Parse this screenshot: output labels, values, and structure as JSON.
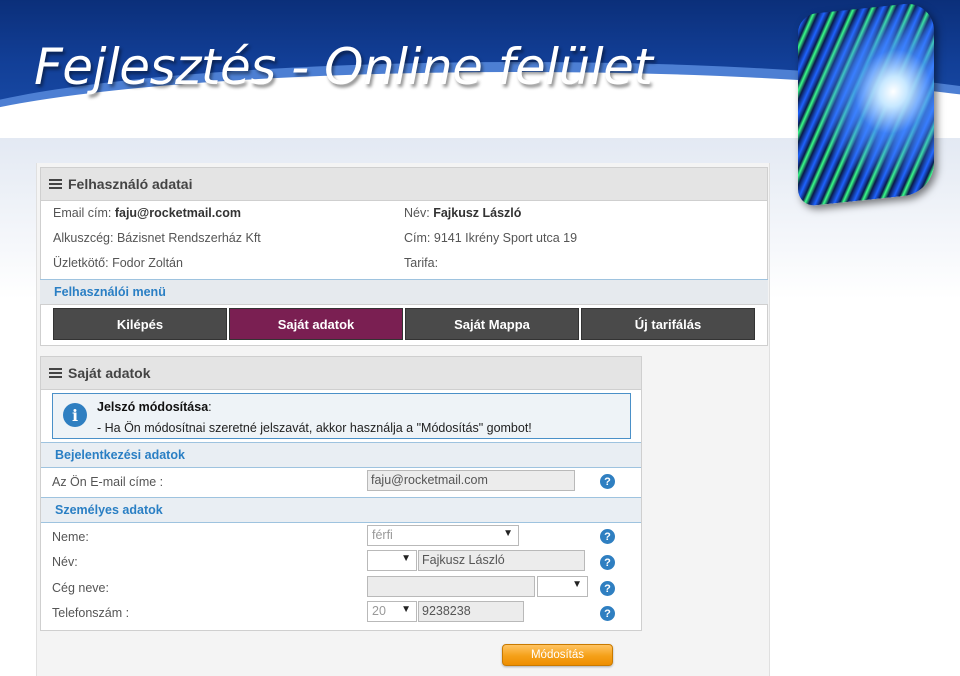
{
  "slide": {
    "title": "Fejlesztés - Online felület",
    "logo_icon": "light-tunnel-logo"
  },
  "user_panel": {
    "title": "Felhasználó adatai",
    "icon": "menu-icon",
    "email_label": "Email cím:",
    "email_value": "faju@rocketmail.com",
    "name_label": "Név:",
    "name_value": "Fajkusz László",
    "subagency_label": "Alkuszcég:",
    "subagency_value": "Bázisnet Rendszerház Kft",
    "address_label": "Cím:",
    "address_value": "9141 Ikrény Sport utca 19",
    "agent_label": "Üzletkötő:",
    "agent_value": "Fodor Zoltán",
    "tariff_label": "Tarifa:",
    "tariff_value": ""
  },
  "user_menu": {
    "title": "Felhasználói menü",
    "items": [
      {
        "label": "Kilépés",
        "active": false
      },
      {
        "label": "Saját adatok",
        "active": true
      },
      {
        "label": "Saját Mappa",
        "active": false
      },
      {
        "label": "Új tarifálás",
        "active": false
      }
    ],
    "colors": {
      "default": "#4a4a4a",
      "active": "#7a1f52"
    }
  },
  "own_data": {
    "title": "Saját adatok",
    "notice": {
      "icon": "info-icon",
      "title": "Jelszó módosítása",
      "title_suffix": ":",
      "text": "- Ha Ön módosítnai szeretné jelszavát, akkor használja a \"Módosítás\" gombot!"
    },
    "login_section": {
      "title": "Bejelentkezési adatok",
      "email_label": "Az Ön E-mail címe :",
      "email_value": "faju@rocketmail.com"
    },
    "personal_section": {
      "title": "Személyes adatok",
      "gender_label": "Neme:",
      "gender_value": "férfi",
      "name_label": "Név:",
      "name_prefix_value": "",
      "name_value": "Fajkusz László",
      "company_label": "Cég neve:",
      "company_value": "",
      "company_type_value": "",
      "phone_label": "Telefonszám :",
      "phone_area_value": "20",
      "phone_value": "9238238"
    },
    "help_glyph": "?",
    "dropdown_glyph": "▼",
    "submit_label": "Módosítás"
  },
  "colors": {
    "header_blue": "#123f97",
    "accent_blue": "#2a7fc4",
    "active_menu": "#7a1f52",
    "submit_orange": "#f5a018"
  }
}
